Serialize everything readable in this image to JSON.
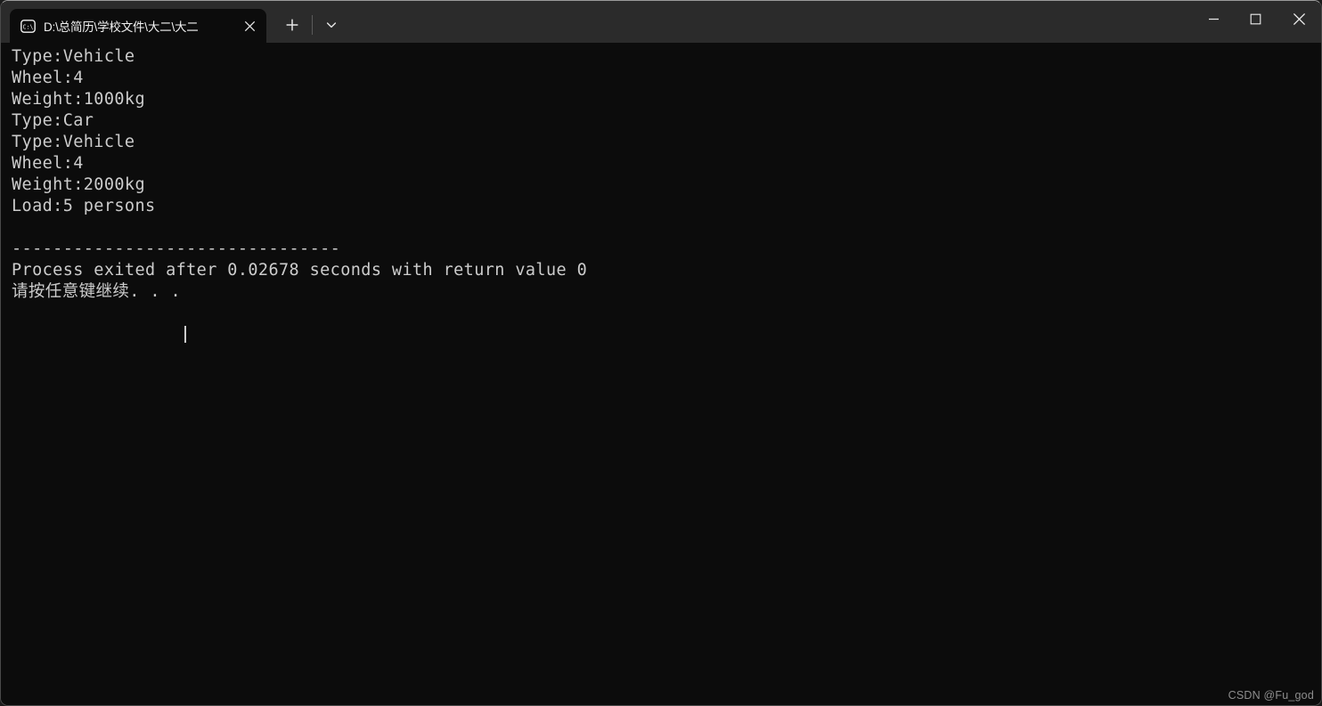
{
  "window": {
    "titlebar_color": "#2b2b2b",
    "body_color": "#0c0c0c",
    "text_color": "#cccccc"
  },
  "titlebar": {
    "tabs": [
      {
        "icon": "command-prompt-icon",
        "icon_label": "C:\\",
        "title": "D:\\总简历\\学校文件\\大二\\大二",
        "active": true,
        "close_label": "✕"
      }
    ],
    "new_tab_label": "+",
    "tab_menu_label": "⌄",
    "caption_buttons": [
      {
        "name": "minimize",
        "label": "—"
      },
      {
        "name": "maximize",
        "label": "□"
      },
      {
        "name": "close",
        "label": "✕"
      }
    ]
  },
  "terminal": {
    "lines": [
      "Type:Vehicle",
      "Wheel:4",
      "Weight:1000kg",
      "Type:Car",
      "Type:Vehicle",
      "Wheel:4",
      "Weight:2000kg",
      "Load:5 persons",
      "",
      "--------------------------------",
      "Process exited after 0.02678 seconds with return value 0",
      "请按任意键继续. . ."
    ],
    "full_text": "Type:Vehicle\nWheel:4\nWeight:1000kg\nType:Car\nType:Vehicle\nWheel:4\nWeight:2000kg\nLoad:5 persons\n\n--------------------------------\nProcess exited after 0.02678 seconds with return value 0\n请按任意键继续. . .",
    "exit_info": {
      "elapsed_seconds": "0.02678",
      "return_value": "0"
    },
    "prompt": "请按任意键继续. . .",
    "cursor_visible": true
  },
  "watermark": {
    "text": "CSDN @Fu_god"
  }
}
